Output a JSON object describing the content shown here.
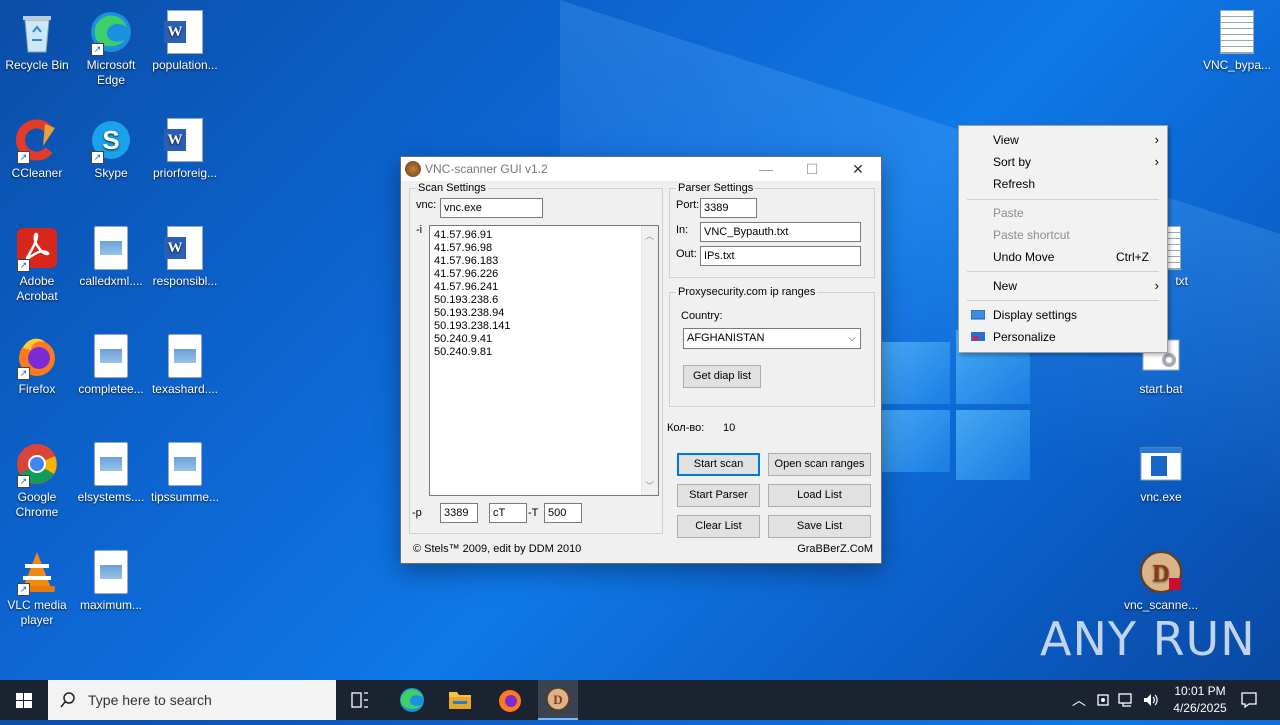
{
  "desktop": {
    "icons": [
      {
        "label": "Recycle Bin"
      },
      {
        "label": "Microsoft Edge"
      },
      {
        "label": "population..."
      },
      {
        "label": "CCleaner"
      },
      {
        "label": "Skype"
      },
      {
        "label": "priorforeig..."
      },
      {
        "label": "Adobe Acrobat"
      },
      {
        "label": "calledxml...."
      },
      {
        "label": "responsibl..."
      },
      {
        "label": "Firefox"
      },
      {
        "label": "completee..."
      },
      {
        "label": "texashard...."
      },
      {
        "label": "Google Chrome"
      },
      {
        "label": "elsystems...."
      },
      {
        "label": "tipssumme..."
      },
      {
        "label": "VLC media player"
      },
      {
        "label": "maximum..."
      },
      {
        "label": "VNC_bypa..."
      },
      {
        "label": "txt"
      },
      {
        "label": "start.bat"
      },
      {
        "label": "vnc.exe"
      },
      {
        "label": "vnc_scanne..."
      }
    ]
  },
  "window": {
    "title": "VNC-scanner GUI v1.2",
    "scan_settings": {
      "group_label": "Scan Settings",
      "vnc_label": "vnc:",
      "vnc_value": "vnc.exe",
      "i_label": "-i",
      "ips": [
        "41.57.96.91",
        "41.57.96.98",
        "41.57.96.183",
        "41.57.96.226",
        "41.57.96.241",
        "50.193.238.6",
        "50.193.238.94",
        "50.193.238.141",
        "50.240.9.41",
        "50.240.9.81"
      ],
      "p_label": "-p",
      "p_value": "3389",
      "ct_value": "cT",
      "t_label": "-T",
      "t_value": "500"
    },
    "parser_settings": {
      "group_label": "Parser Settings",
      "port_label": "Port:",
      "port_value": "3389",
      "in_label": "In:",
      "in_value": "VNC_Bypauth.txt",
      "out_label": "Out:",
      "out_value": "IPs.txt"
    },
    "proxy": {
      "group_label": "Proxysecurity.com ip ranges",
      "country_label": "Country:",
      "country_value": "AFGHANISTAN",
      "get_button": "Get diap list"
    },
    "count_label": "Кол-во:",
    "count_value": "10",
    "buttons": {
      "start_scan": "Start scan",
      "open_scan_ranges": "Open scan ranges",
      "start_parser": "Start Parser",
      "load_list": "Load List",
      "clear_list": "Clear List",
      "save_list": "Save List"
    },
    "footer_left": "© Stels™ 2009, edit by DDM 2010",
    "footer_right": "GraBBerZ.CoM"
  },
  "context_menu": {
    "view": "View",
    "sort_by": "Sort by",
    "refresh": "Refresh",
    "paste": "Paste",
    "paste_shortcut": "Paste shortcut",
    "undo_move": "Undo Move",
    "undo_shortcut": "Ctrl+Z",
    "new": "New",
    "display_settings": "Display settings",
    "personalize": "Personalize"
  },
  "taskbar": {
    "search_placeholder": "Type here to search",
    "time": "10:01 PM",
    "date": "4/26/2025"
  },
  "watermark": "ANY RUN"
}
